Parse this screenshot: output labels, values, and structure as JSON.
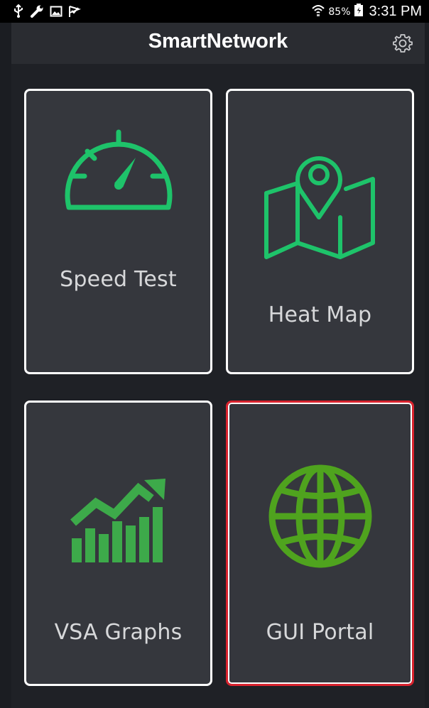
{
  "status_bar": {
    "battery_percent": "85%",
    "time": "3:31 PM",
    "icons_left": [
      "usb-icon",
      "wrench-icon",
      "image-icon",
      "check-flag-icon"
    ],
    "icons_right": [
      "wifi-icon",
      "battery-icon"
    ]
  },
  "app_bar": {
    "title": "SmartNetwork",
    "settings_icon": "gear-icon"
  },
  "tiles": [
    {
      "label": "Speed Test",
      "icon": "speedometer-icon",
      "color": "#1ec36a",
      "selected": false
    },
    {
      "label": "Heat Map",
      "icon": "map-pin-icon",
      "color": "#1ec36a",
      "selected": false
    },
    {
      "label": "VSA Graphs",
      "icon": "bar-chart-trend-icon",
      "color": "#3daa4a",
      "selected": false
    },
    {
      "label": "GUI Portal",
      "icon": "globe-icon",
      "color": "#4fa31e",
      "selected": true
    }
  ],
  "colors": {
    "background": "#1b1d22",
    "tile_background": "#35373d",
    "tile_border": "#ffffff",
    "selection_border": "#d9232e",
    "label_text": "#d7d8da"
  }
}
